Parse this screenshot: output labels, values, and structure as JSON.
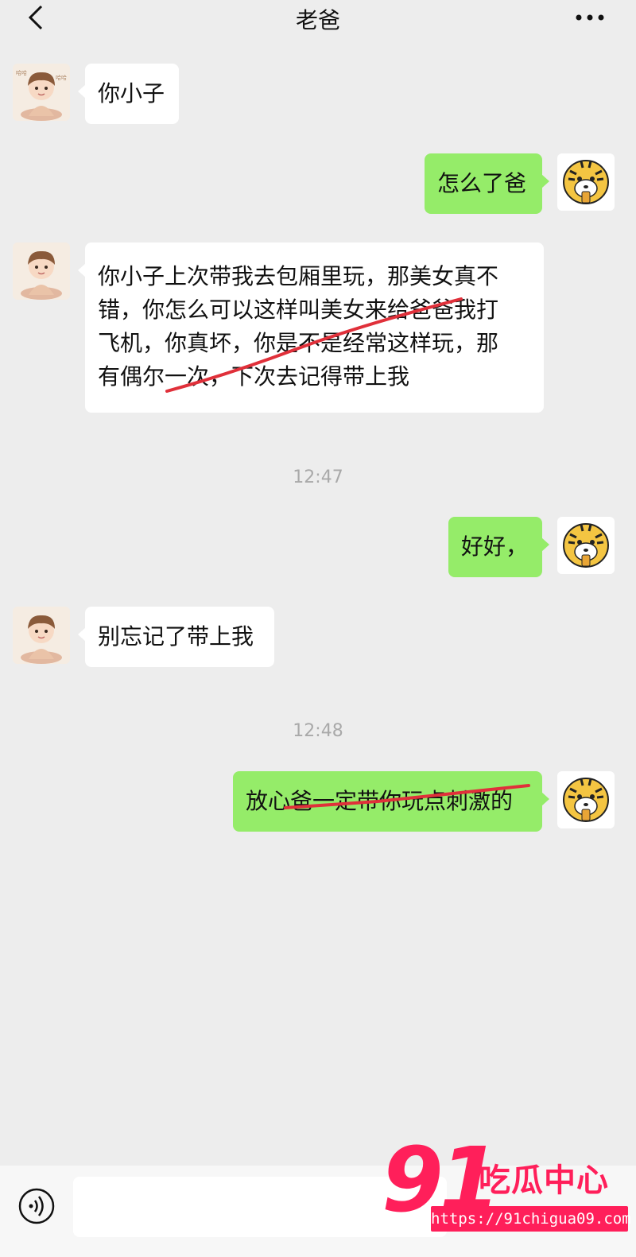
{
  "header": {
    "title": "老爸"
  },
  "icons": [
    "back-arrow-icon",
    "more-dots-icon",
    "voice-icon"
  ],
  "messages": [
    {
      "side": "in",
      "text": "你小子"
    },
    {
      "side": "out",
      "text": "怎么了爸"
    },
    {
      "side": "in",
      "lines": [
        "你小子上次带我去包厢里玩，那美女真不",
        "错，你怎么可以这样叫美女来给爸爸我打",
        "飞机，你真坏，你是不是经常这样玩，那",
        "有偶尔一次，下次去记得带上我"
      ]
    },
    {
      "type": "time",
      "text": "12:47"
    },
    {
      "side": "out",
      "text": "好好，"
    },
    {
      "side": "in",
      "text": "别忘记了带上我"
    },
    {
      "type": "time",
      "text": "12:48"
    },
    {
      "side": "out",
      "text": "放心爸一定带你玩点刺激的"
    }
  ],
  "watermark": {
    "number": "91",
    "name": "吃瓜中心",
    "url": "https://91chigua09.com"
  },
  "colors": {
    "background": "#ededed",
    "outgoing_bubble": "#95ec69",
    "incoming_bubble": "#ffffff",
    "watermark": "#ff1f5a",
    "scribble": "#e0303a"
  }
}
